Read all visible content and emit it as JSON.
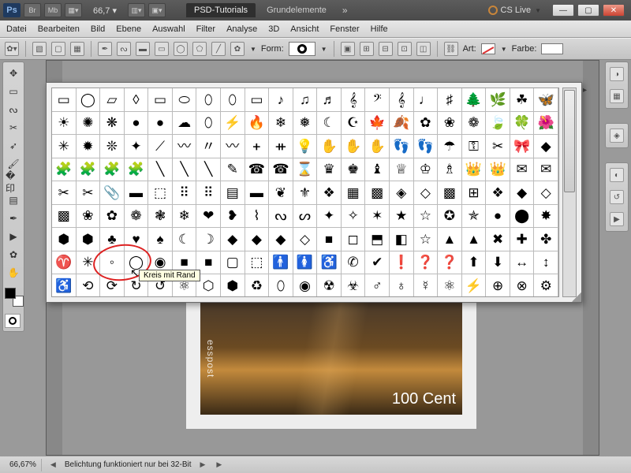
{
  "titlebar": {
    "app": "Ps",
    "br": "Br",
    "mb": "Mb",
    "zoom": "66,7",
    "tab_active": "PSD-Tutorials",
    "tab_inactive": "Grundelemente",
    "cslive": "CS Live"
  },
  "menubar": [
    "Datei",
    "Bearbeiten",
    "Bild",
    "Ebene",
    "Auswahl",
    "Filter",
    "Analyse",
    "3D",
    "Ansicht",
    "Fenster",
    "Hilfe"
  ],
  "optionsbar": {
    "form_label": "Form:",
    "art_label": "Art:",
    "farbe_label": "Farbe:"
  },
  "tooltip": "Kreis mit Rand",
  "stamp": {
    "side_text": "esspost",
    "value": "100 Cent"
  },
  "statusbar": {
    "zoom": "66,67%",
    "msg": "Belichtung funktioniert nur bei 32-Bit"
  },
  "shapes": {
    "rows": [
      [
        "▭",
        "◯",
        "▱",
        "◊",
        "▭",
        "⬭",
        "⬯",
        "⬯",
        "▭",
        "♪",
        "♫",
        "♬",
        "𝄞",
        "𝄢",
        "𝄞",
        "♩",
        "♯",
        "🌲",
        "🌿",
        "☘",
        "🦋"
      ],
      [
        "☀",
        "✺",
        "❋",
        "●",
        "●",
        "☁",
        "⬯",
        "⚡",
        "🔥",
        "❄",
        "❅",
        "☾",
        "☪",
        "🍁",
        "🍂",
        "✿",
        "❀",
        "❁",
        "🍃",
        "🍀",
        "🌺"
      ],
      [
        "✳",
        "✹",
        "❊",
        "✦",
        "⟋",
        "〰",
        "〃",
        "〰",
        "ᚐ",
        "ᚑ",
        "💡",
        "✋",
        "✋",
        "✋",
        "👣",
        "👣",
        "☂",
        "⚿",
        "✂",
        "🎀",
        "◆"
      ],
      [
        "🧩",
        "🧩",
        "🧩",
        "🧩",
        "╲",
        "╲",
        "╲",
        "✎",
        "☎",
        "☎",
        "⌛",
        "♛",
        "♚",
        "♝",
        "♕",
        "♔",
        "♗",
        "👑",
        "👑",
        "✉",
        "✉"
      ],
      [
        "✂",
        "✂",
        "📎",
        "▬",
        "⬚",
        "⠿",
        "⠿",
        "▤",
        "▬",
        "❦",
        "⚜",
        "❖",
        "▦",
        "▩",
        "◈",
        "◇",
        "▩",
        "⊞",
        "❖",
        "◆",
        "◇"
      ],
      [
        "▩",
        "❀",
        "✿",
        "❁",
        "❃",
        "❄",
        "❤",
        "❥",
        "⌇",
        "ᔓ",
        "ᔕ",
        "✦",
        "✧",
        "✶",
        "★",
        "☆",
        "✪",
        "✯",
        "●",
        "⬤",
        "✸"
      ],
      [
        "⬢",
        "⬢",
        "♣",
        "♥",
        "♠",
        "☾",
        "☽",
        "◆",
        "◆",
        "◆",
        "◇",
        "■",
        "◻",
        "⬒",
        "◧",
        "☆",
        "▲",
        "▲",
        "✖",
        "✚",
        "✤"
      ],
      [
        "♈",
        "✳",
        "◦",
        "◯",
        "◉",
        "■",
        "■",
        "▢",
        "⬚",
        "🚹",
        "🚺",
        "♿",
        "✆",
        "✔",
        "❗",
        "❓",
        "❓",
        "⬆",
        "⬇",
        "↔",
        "↕"
      ],
      [
        "♿",
        "⟲",
        "⟳",
        "↻",
        "↺",
        "⚛",
        "⬡",
        "⬢",
        "♻",
        "⬯",
        "◉",
        "☢",
        "☣",
        "♂",
        "♁",
        "☿",
        "⚛",
        "⚡",
        "⊕",
        "⊗",
        "⚙"
      ]
    ]
  }
}
